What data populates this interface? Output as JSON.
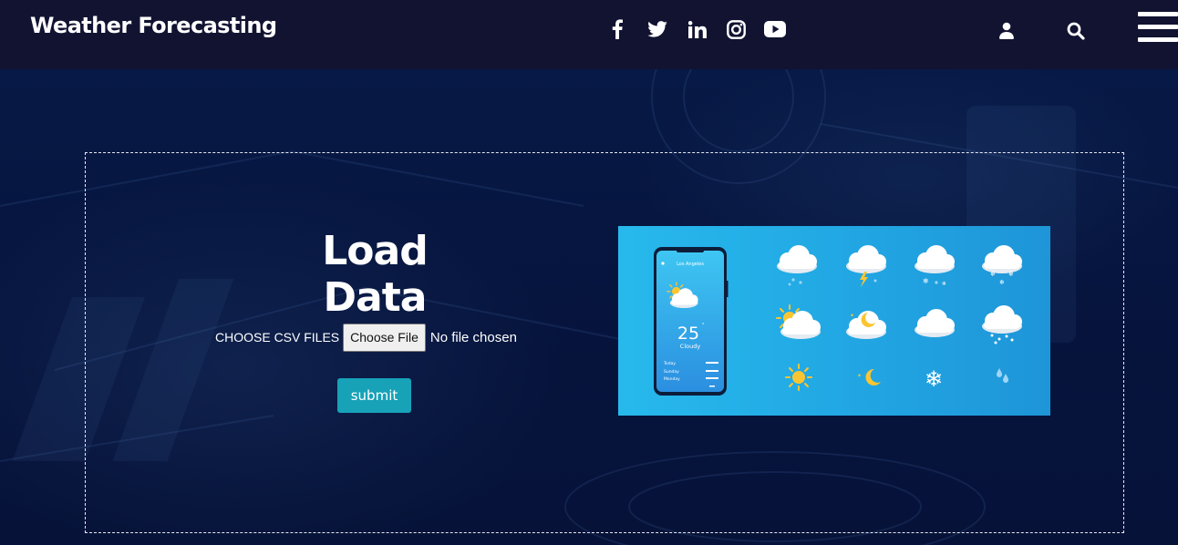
{
  "header": {
    "brand": "Weather Forecasting",
    "social_icons": [
      "facebook-icon",
      "twitter-icon",
      "linkedin-icon",
      "instagram-icon",
      "youtube-icon"
    ],
    "right_icons": [
      "user-icon",
      "search-icon",
      "hamburger-menu-icon"
    ]
  },
  "main": {
    "title": "Load Data",
    "upload_label": "CHOOSE CSV FILES",
    "choose_button": "Choose File",
    "file_status": "No file chosen",
    "submit_label": "submit"
  },
  "illustration": {
    "phone_city": "Los Angeles",
    "phone_temp": "25",
    "phone_condition": "Cloudy",
    "phone_days": [
      "Today",
      "Sunday",
      "Monday"
    ]
  },
  "colors": {
    "header_bg": "#111331",
    "page_bg": "#06143d",
    "submit_bg": "#17a2b8",
    "illustration_bg": "#22a8e4"
  }
}
